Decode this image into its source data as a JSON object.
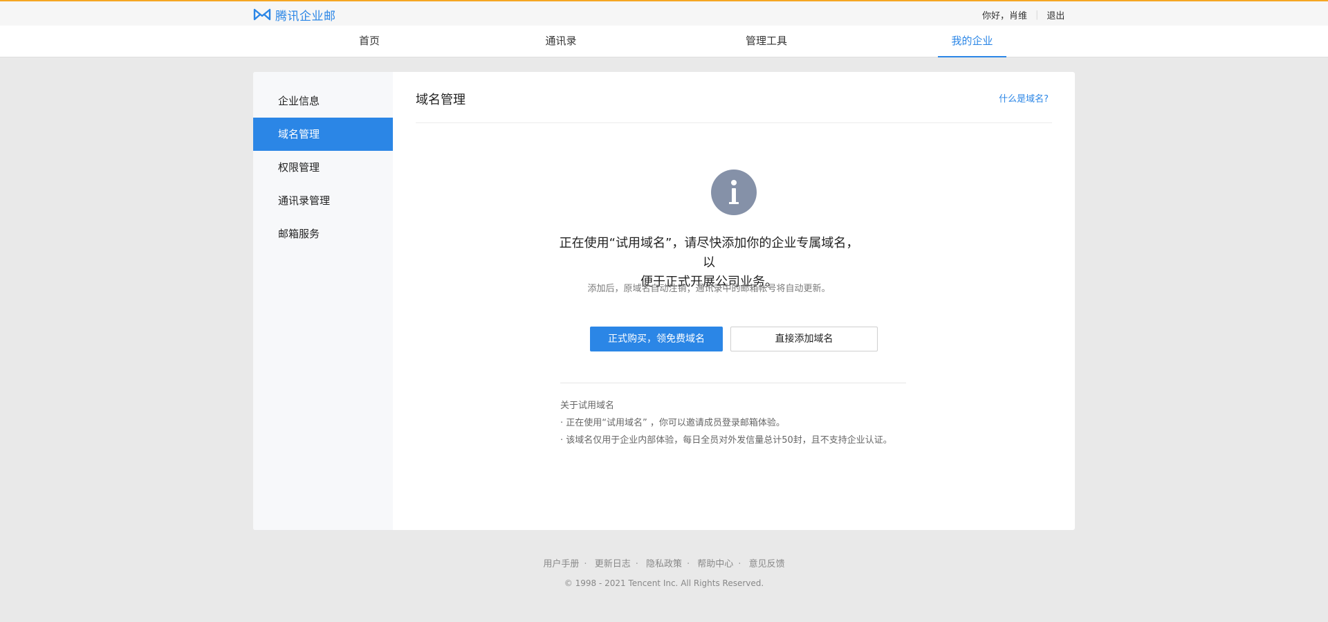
{
  "brand": {
    "name": "腾讯企业邮",
    "accent": "#2b86e6"
  },
  "user": {
    "greeting": "你好，肖维",
    "logout": "退出"
  },
  "nav": {
    "items": [
      {
        "label": "首页"
      },
      {
        "label": "通讯录"
      },
      {
        "label": "管理工具"
      },
      {
        "label": "我的企业"
      }
    ],
    "active": "我的企业"
  },
  "sidebar": {
    "items": [
      {
        "label": "企业信息"
      },
      {
        "label": "域名管理"
      },
      {
        "label": "权限管理"
      },
      {
        "label": "通讯录管理"
      },
      {
        "label": "邮箱服务"
      }
    ],
    "active": "域名管理"
  },
  "main": {
    "title": "域名管理",
    "help_link": "什么是域名?",
    "message_line1": "正在使用“试用域名”，请尽快添加你的企业专属域名，以",
    "message_line2": "便于正式开展公司业务。",
    "sub_message": "添加后，原域名自动注销；通讯录中的邮箱帐号将自动更新。",
    "primary_button": "正式购买，领免费域名",
    "secondary_button": "直接添加域名",
    "about_title": "关于试用域名",
    "about_items": [
      "· 正在使用“试用域名” ，你可以邀请成员登录邮箱体验。",
      "· 该域名仅用于企业内部体验，每日全员对外发信量总计50封，且不支持企业认证。"
    ]
  },
  "footer": {
    "links": [
      "用户手册",
      "更新日志",
      "隐私政策",
      "帮助中心",
      "意见反馈"
    ],
    "copyright": "© 1998 - 2021 Tencent Inc. All Rights Reserved."
  }
}
